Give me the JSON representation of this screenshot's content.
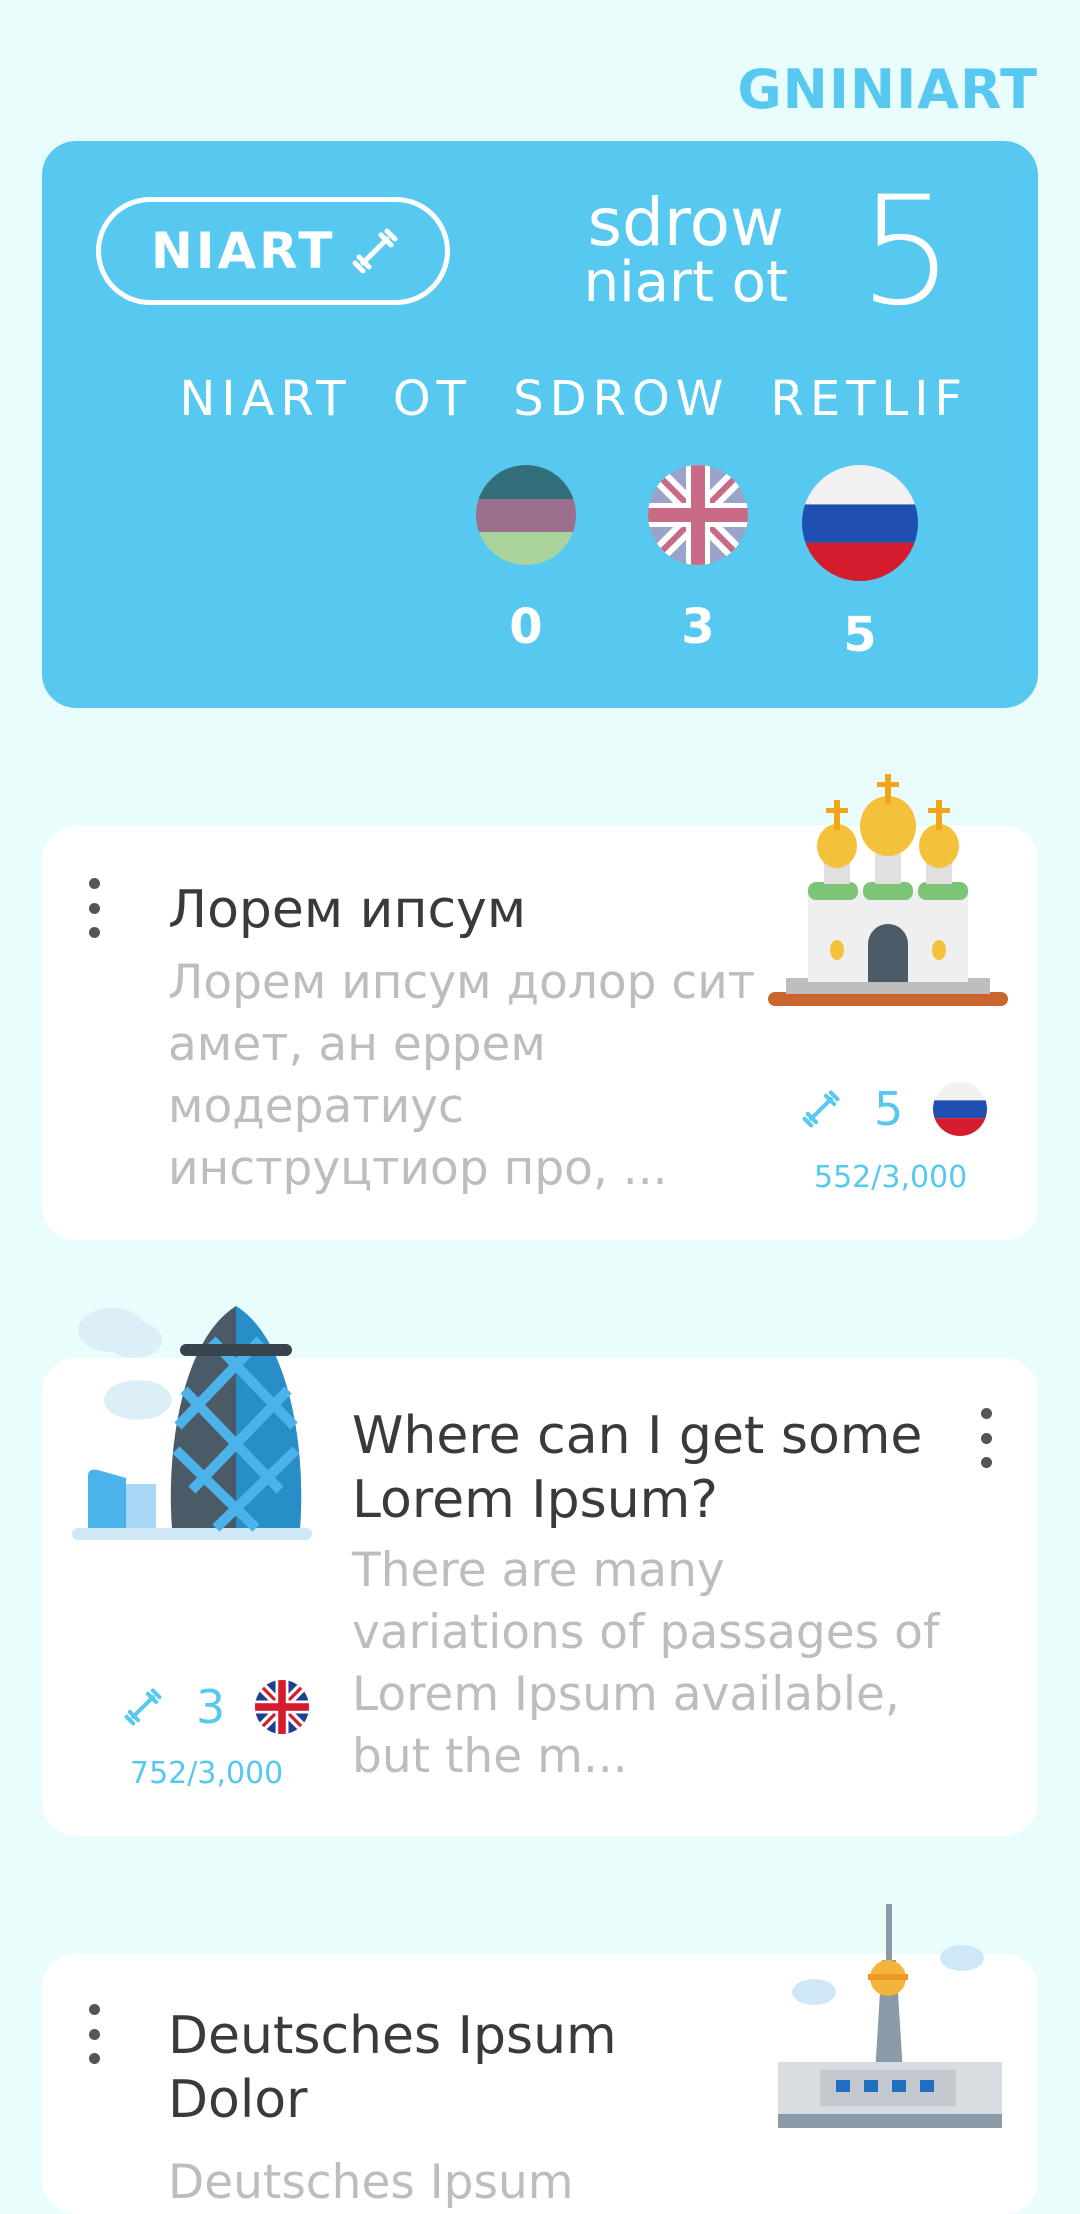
{
  "header": {
    "title": "GNINIART"
  },
  "summary": {
    "train_button_label": "NIART",
    "words_label_line1": "sdrow",
    "words_label_line2": "niart ot",
    "words_count": "5",
    "filter_label": "NIART OT SDROW RETLIF",
    "flags": [
      {
        "name": "mixed-flag-icon",
        "count": "0"
      },
      {
        "name": "uk-flag-icon",
        "count": "3"
      },
      {
        "name": "russia-flag-icon",
        "count": "5"
      }
    ]
  },
  "cards": [
    {
      "title": "Лорем ипсум",
      "description": "Лорем ипсум долор сит амет, ан еррем модератиус инструцтиор про, ...",
      "train_count": "5",
      "progress": "552/3,000",
      "flag": "russia-flag-icon",
      "illustration": "church-icon"
    },
    {
      "title": "Where can I get some Lorem Ipsum?",
      "description": "There are many variations of passages of Lorem Ipsum available, but the m...",
      "train_count": "3",
      "progress": "752/3,000",
      "flag": "uk-flag-icon",
      "illustration": "gherkin-tower-icon"
    },
    {
      "title": "Deutsches Ipsum Dolor",
      "description": "Deutsches Ipsum",
      "illustration": "tv-tower-icon"
    }
  ],
  "colors": {
    "accent": "#57c9f1",
    "background": "#eafdfd"
  }
}
